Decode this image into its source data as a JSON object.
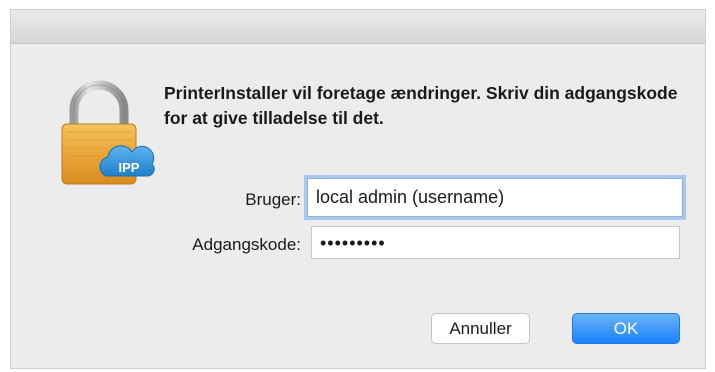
{
  "dialog": {
    "message": "PrinterInstaller vil foretage ændringer. Skriv din adgangskode for at give tilladelse til det.",
    "icon": "padlock-ipp-icon",
    "badge_text": "IPP"
  },
  "form": {
    "user_label": "Bruger:",
    "user_value": "local admin (username)",
    "password_label": "Adgangskode:",
    "password_value": "•••••••••"
  },
  "buttons": {
    "cancel_label": "Annuller",
    "ok_label": "OK"
  },
  "colors": {
    "accent": "#1a82fb",
    "lock_body": "#e9a63a",
    "cloud_badge": "#2f8fd8"
  }
}
